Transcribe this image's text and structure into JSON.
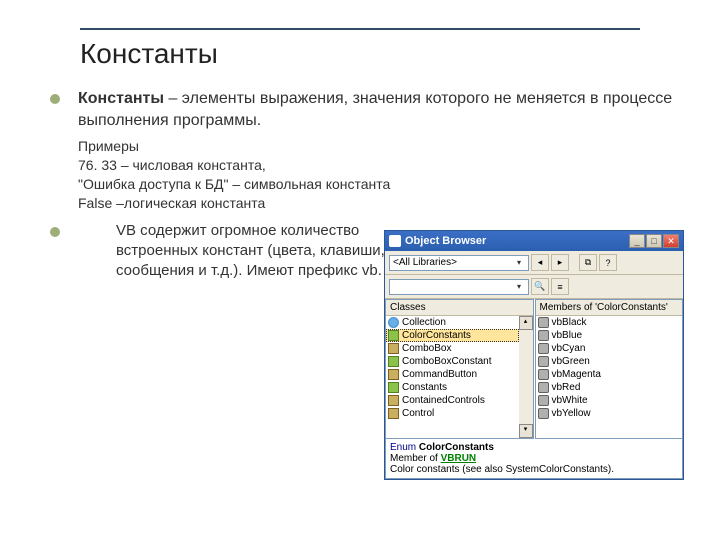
{
  "title": "Константы",
  "definition_bold": "Константы",
  "definition_rest": " – элементы выражения, значения которого не меняется в процессе выполнения программы.",
  "examples_header": "Примеры",
  "examples": [
    "76. 33 – числовая константа,",
    "\"Ошибка доступа к БД\" – символьная константа",
    "False –логическая константа"
  ],
  "body_text": "VB содержит огромное количество встроенных констант (цвета, клавиши, сообщения и т.д.). Имеют префикс vb.",
  "object_browser": {
    "title": "Object Browser",
    "lib_combo": "<All Libraries>",
    "search_combo": "",
    "classes_header": "Classes",
    "members_header": "Members of 'ColorConstants'",
    "classes": [
      {
        "name": "Collection",
        "icon": "class"
      },
      {
        "name": "ColorConstants",
        "icon": "enum",
        "selected": true
      },
      {
        "name": "ComboBox",
        "icon": "class"
      },
      {
        "name": "ComboBoxConstant",
        "icon": "enum"
      },
      {
        "name": "CommandButton",
        "icon": "class"
      },
      {
        "name": "Constants",
        "icon": "enum"
      },
      {
        "name": "ContainedControls",
        "icon": "class"
      },
      {
        "name": "Control",
        "icon": "class"
      }
    ],
    "members": [
      {
        "name": "vbBlack",
        "icon": "const"
      },
      {
        "name": "vbBlue",
        "icon": "const"
      },
      {
        "name": "vbCyan",
        "icon": "const"
      },
      {
        "name": "vbGreen",
        "icon": "const"
      },
      {
        "name": "vbMagenta",
        "icon": "const"
      },
      {
        "name": "vbRed",
        "icon": "const"
      },
      {
        "name": "vbWhite",
        "icon": "const"
      },
      {
        "name": "vbYellow",
        "icon": "const"
      }
    ],
    "details_line1_prefix": "Enum ",
    "details_line1_name": "ColorConstants",
    "details_line2_prefix": "Member of ",
    "details_line2_link": "VBRUN",
    "details_line3": "Color constants (see also SystemColorConstants)."
  }
}
